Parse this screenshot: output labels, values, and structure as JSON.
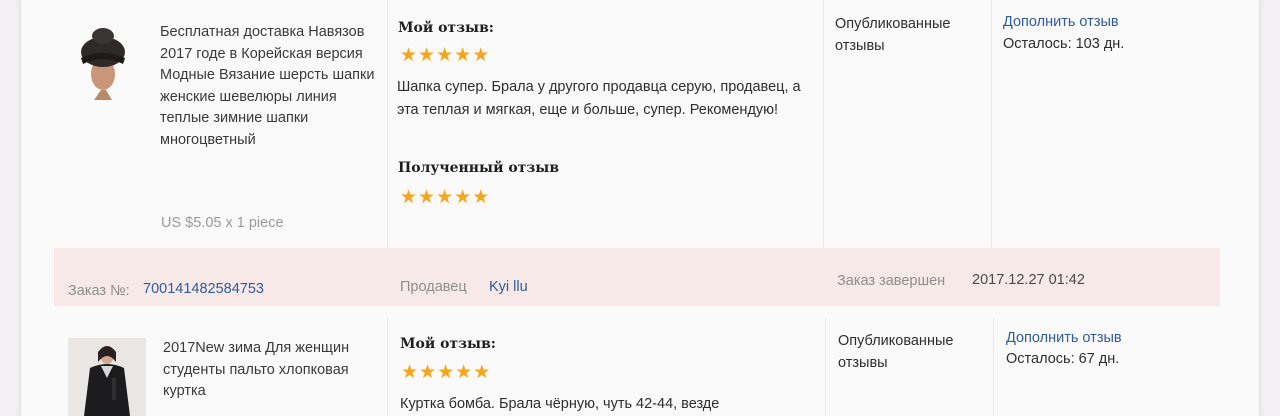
{
  "orders": [
    {
      "product_title": "Бесплатная доставка Навязов 2017 годе в Корейская версия Модные Вязание шерсть шапки женские шевелюры линия теплые зимние шапки многоцветный",
      "price": "US $5.05 x 1 piece",
      "my_feedback_title": "Мой отзыв:",
      "my_rating": 5,
      "my_feedback_text": "Шапка супер. Брала у другого продавца серую, продавец, а эта теплая и мягкая, еще и больше, супер. Рекомендую!",
      "received_feedback_title": "Полученный отзыв",
      "received_rating": 5,
      "status": "Опубликованные отзывы",
      "add_feedback_label": "Дополнить отзыв",
      "remaining": "Осталось: 103 дн."
    },
    {
      "product_title": "2017New зима Для женщин студенты пальто хлопковая куртка",
      "my_feedback_title": "Мой отзыв:",
      "my_rating": 5,
      "my_feedback_text": "Куртка бомба. Брала чёрную, чуть 42-44, везде",
      "status": "Опубликованные отзывы",
      "add_feedback_label": "Дополнить отзыв",
      "remaining": "Осталось: 67 дн."
    }
  ],
  "order_bar": {
    "order_label": "Заказ №:",
    "order_number": "700141482584753",
    "seller_label": "Продавец",
    "seller_name": "Kyi llu",
    "completed_label": "Заказ завершен",
    "completed_date": "2017.12.27 01:42"
  },
  "colors": {
    "star": "#f7a51c",
    "link": "#2e5c9e",
    "bar_background": "#f8e9e9"
  },
  "icons": {
    "star": "star-icon"
  }
}
